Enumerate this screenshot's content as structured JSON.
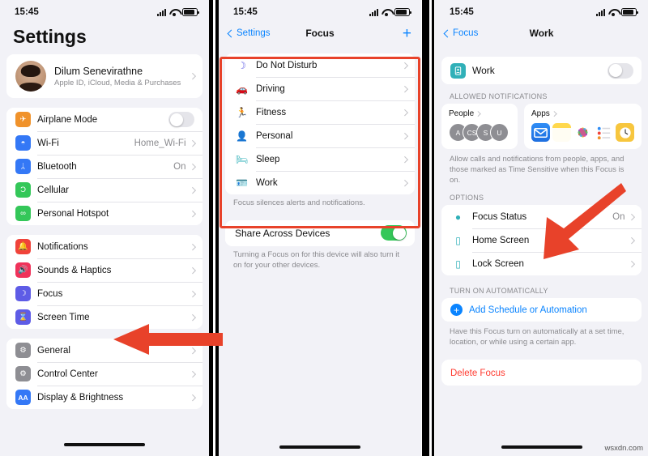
{
  "watermark": "wsxdn.com",
  "colors": {
    "accent_blue": "#0a84ff",
    "annotation_red": "#e8422a",
    "destructive_red": "#ff3b30",
    "toggle_green": "#34c759"
  },
  "panel1": {
    "status": {
      "time": "15:45",
      "signal_icon": "cellular-signal-icon",
      "wifi_icon": "wifi-icon",
      "battery_icon": "battery-icon"
    },
    "title": "Settings",
    "account": {
      "name": "Dilum Senevirathne",
      "subtitle": "Apple ID, iCloud, Media & Purchases",
      "avatar_name": "user-avatar"
    },
    "group1": [
      {
        "label": "Airplane Mode",
        "icon": "airplane-icon",
        "icon_color": "#f0922b",
        "glyph": "✈",
        "control": "toggle",
        "toggle_on": false
      },
      {
        "label": "Wi-Fi",
        "icon": "wifi-icon",
        "icon_color": "#3478f6",
        "glyph": "◓",
        "value": "Home_Wi-Fi",
        "control": "chevron"
      },
      {
        "label": "Bluetooth",
        "icon": "bluetooth-icon",
        "icon_color": "#3478f6",
        "glyph": "ᛦ",
        "value": "On",
        "control": "chevron"
      },
      {
        "label": "Cellular",
        "icon": "cellular-icon",
        "icon_color": "#34c759",
        "glyph": "Ɔ",
        "value": "",
        "control": "chevron"
      },
      {
        "label": "Personal Hotspot",
        "icon": "hotspot-icon",
        "icon_color": "#34c759",
        "glyph": "∞",
        "value": "",
        "control": "chevron"
      }
    ],
    "group2": [
      {
        "label": "Notifications",
        "icon": "bell-icon",
        "icon_color": "#f0433a",
        "glyph": "🔔",
        "control": "chevron"
      },
      {
        "label": "Sounds & Haptics",
        "icon": "speaker-icon",
        "icon_color": "#f0325a",
        "glyph": "🔊",
        "control": "chevron"
      },
      {
        "label": "Focus",
        "icon": "moon-icon",
        "icon_color": "#5e5ce6",
        "glyph": "☽",
        "control": "chevron"
      },
      {
        "label": "Screen Time",
        "icon": "hourglass-icon",
        "icon_color": "#5e5ce6",
        "glyph": "⌛",
        "control": "chevron"
      }
    ],
    "group3": [
      {
        "label": "General",
        "icon": "gear-icon",
        "icon_color": "#8e8e93",
        "glyph": "⚙",
        "control": "chevron"
      },
      {
        "label": "Control Center",
        "icon": "control-center-icon",
        "icon_color": "#8e8e93",
        "glyph": "⚙",
        "control": "chevron"
      },
      {
        "label": "Display & Brightness",
        "icon": "display-icon",
        "icon_color": "#3478f6",
        "glyph": "AA",
        "control": "chevron"
      }
    ]
  },
  "panel2": {
    "status": {
      "time": "15:45"
    },
    "nav": {
      "back_label": "Settings",
      "title": "Focus",
      "add_label": "+"
    },
    "focus_list": [
      {
        "label": "Do Not Disturb",
        "icon": "moon-icon",
        "icon_color": "#5e5ce6",
        "glyph": "☽"
      },
      {
        "label": "Driving",
        "icon": "car-icon",
        "icon_color": "#5e5ce6",
        "glyph": "🚗"
      },
      {
        "label": "Fitness",
        "icon": "running-icon",
        "icon_color": "#34c759",
        "glyph": "🏃"
      },
      {
        "label": "Personal",
        "icon": "person-icon",
        "icon_color": "#a855f7",
        "glyph": "👤"
      },
      {
        "label": "Sleep",
        "icon": "bed-icon",
        "icon_color": "#30b0b8",
        "glyph": "🛏"
      },
      {
        "label": "Work",
        "icon": "badge-icon",
        "icon_color": "#30b0b8",
        "glyph": "🪪"
      }
    ],
    "focus_footer": "Focus silences alerts and notifications.",
    "share": {
      "label": "Share Across Devices",
      "toggle_on": true
    },
    "share_footer": "Turning a Focus on for this device will also turn it on for your other devices."
  },
  "panel3": {
    "status": {
      "time": "15:45"
    },
    "nav": {
      "back_label": "Focus",
      "title": "Work"
    },
    "work_toggle": {
      "label": "Work",
      "icon": "badge-icon",
      "icon_color": "#30b0b8",
      "glyph": "🪪",
      "toggle_on": false
    },
    "allowed_header": "ALLOWED NOTIFICATIONS",
    "people": {
      "label": "People",
      "avatars": [
        "A",
        "CS",
        "S",
        "U"
      ]
    },
    "apps": {
      "label": "Apps",
      "icons": [
        "mail-app-icon",
        "notes-app-icon",
        "photos-app-icon",
        "reminders-app-icon",
        "clock-app-icon"
      ]
    },
    "allowed_footer": "Allow calls and notifications from people, apps, and those marked as Time Sensitive when this Focus is on.",
    "options_header": "OPTIONS",
    "options": [
      {
        "label": "Focus Status",
        "icon": "focus-status-icon",
        "value": "On"
      },
      {
        "label": "Home Screen",
        "icon": "home-screen-icon",
        "value": ""
      },
      {
        "label": "Lock Screen",
        "icon": "lock-screen-icon",
        "value": ""
      }
    ],
    "auto_header": "TURN ON AUTOMATICALLY",
    "add_schedule": "Add Schedule or Automation",
    "auto_footer": "Have this Focus turn on automatically at a set time, location, or while using a certain app.",
    "delete": "Delete Focus"
  }
}
